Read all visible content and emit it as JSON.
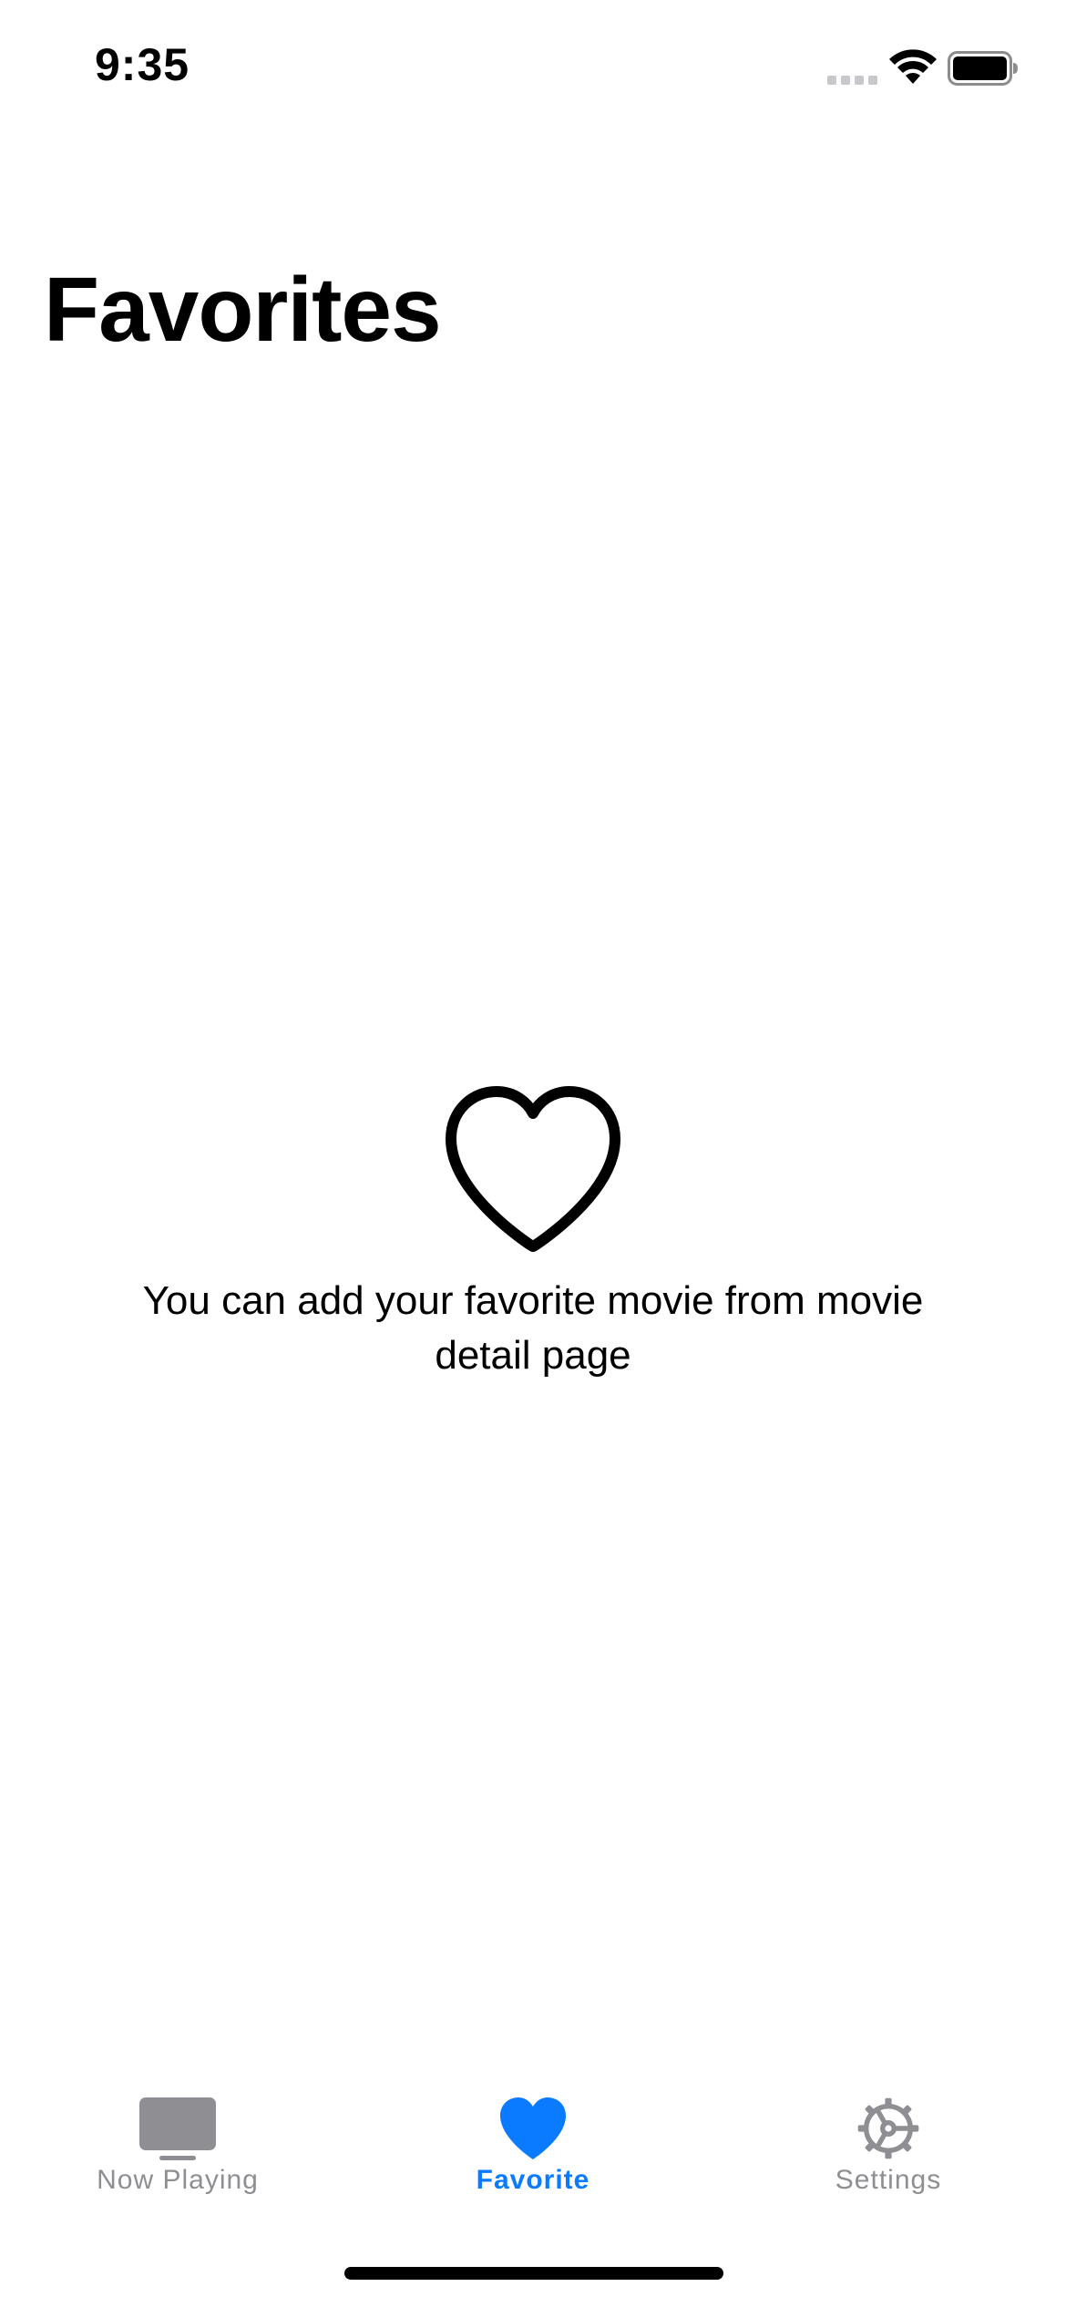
{
  "status_bar": {
    "time": "9:35",
    "icons": [
      "cellular-signal-icon",
      "wifi-icon",
      "battery-icon"
    ]
  },
  "header": {
    "title": "Favorites"
  },
  "empty_state": {
    "icon": "heart-outline-icon",
    "message": "You can add your favorite movie from movie detail page"
  },
  "tab_bar": {
    "items": [
      {
        "label": "Now Playing",
        "icon": "tv-icon",
        "selected": false
      },
      {
        "label": "Favorite",
        "icon": "heart-filled-icon",
        "selected": true
      },
      {
        "label": "Settings",
        "icon": "gear-icon",
        "selected": false
      }
    ]
  },
  "colors": {
    "accent": "#0a7bff",
    "inactive": "#8e8e93",
    "background": "#ffffff",
    "text": "#000000"
  }
}
